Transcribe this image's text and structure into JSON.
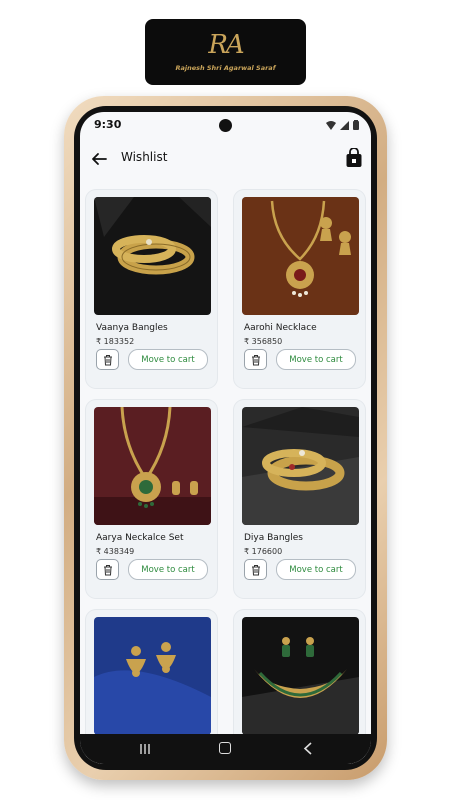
{
  "brand": {
    "logo_mark": "RA",
    "logo_text": "Rajnesh Shri Agarwal Saraf",
    "accent_color": "#c9a45a"
  },
  "status_bar": {
    "time": "9:30"
  },
  "header": {
    "title": "Wishlist",
    "back_icon": "arrow-left-icon",
    "bag_icon": "shopping-bag-icon"
  },
  "colors": {
    "move_to_cart_text": "#2e8b3e",
    "card_bg": "#f0f3f6"
  },
  "wishlist": {
    "items": [
      {
        "name": "Vaanya Bangles",
        "price": "₹ 183352",
        "move_label": "Move to cart",
        "image": "gold-bangles-dark-bg"
      },
      {
        "name": "Aarohi Necklace",
        "price": "₹ 356850",
        "move_label": "Move to cart",
        "image": "gold-necklace-earrings-brown-bg"
      },
      {
        "name": "Aarya Neckalce Set",
        "price": "₹ 438349",
        "move_label": "Move to cart",
        "image": "gold-necklace-set-maroon-bg"
      },
      {
        "name": "Diya Bangles",
        "price": "₹ 176600",
        "move_label": "Move to cart",
        "image": "gold-bangles-stone-bg"
      },
      {
        "name": "",
        "price": "",
        "move_label": "",
        "image": "gold-earrings-blue-bg"
      },
      {
        "name": "",
        "price": "",
        "move_label": "",
        "image": "gold-choker-necklace-dark-bg"
      }
    ]
  }
}
